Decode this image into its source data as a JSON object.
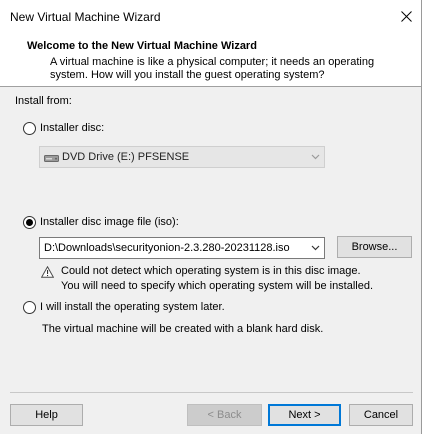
{
  "window": {
    "title": "New Virtual Machine Wizard",
    "close_glyph": "✕"
  },
  "header": {
    "title": "Welcome to the New Virtual Machine Wizard",
    "description": "A virtual machine is like a physical computer; it needs an operating system. How will you install the guest operating system?"
  },
  "install_from": {
    "label": "Install from:",
    "installer_disc": {
      "label": "Installer disc:",
      "selected": false,
      "drive_value": "DVD Drive (E:) PFSENSE",
      "drive_icon": "dvd-drive-icon"
    },
    "iso_option": {
      "label": "Installer disc image file (iso):",
      "selected": true,
      "path_value": "D:\\Downloads\\securityonion-2.3.280-20231128.iso",
      "browse_label": "Browse...",
      "warning_line1": "Could not detect which operating system is in this disc image.",
      "warning_line2": "You will need to specify which operating system will be installed.",
      "warning_icon": "warning-triangle-icon"
    },
    "later_option": {
      "label": "I will install the operating system later.",
      "selected": false,
      "note": "The virtual machine will be created with a blank hard disk."
    }
  },
  "footer": {
    "help_label": "Help",
    "back_label": "< Back",
    "next_label": "Next >",
    "cancel_label": "Cancel"
  },
  "colors": {
    "dialog_bg": "#f0f0f0",
    "header_bg": "#ffffff",
    "default_button_border": "#0078d7"
  }
}
